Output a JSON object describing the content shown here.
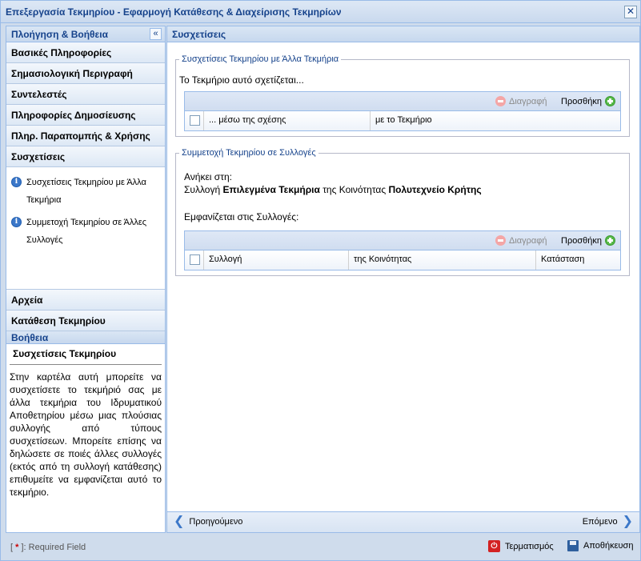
{
  "window": {
    "title": "Επεξεργασία Τεκμηρίου - Εφαρμογή Κατάθεσης & Διαχείρισης Τεκμηρίων",
    "close_glyph": "✕"
  },
  "sidebar": {
    "header": "Πλοήγηση & Βοήθεια",
    "collapse_glyph": "«",
    "items": [
      {
        "label": "Βασικές Πληροφορίες"
      },
      {
        "label": "Σημασιολογική Περιγραφή"
      },
      {
        "label": "Συντελεστές"
      },
      {
        "label": "Πληροφορίες Δημοσίευσης"
      },
      {
        "label": "Πληρ. Παραπομπής & Χρήσης"
      },
      {
        "label": "Συσχετίσεις"
      }
    ],
    "subitems": [
      {
        "label": "Συσχετίσεις Τεκμηρίου με Άλλα Τεκμήρια",
        "icon": "info-icon"
      },
      {
        "label": "Συμμετοχή Τεκμηρίου σε Άλλες Συλλογές",
        "icon": "info-icon"
      }
    ],
    "bottom_items": [
      {
        "label": "Αρχεία"
      },
      {
        "label": "Κατάθεση Τεκμηρίου"
      }
    ]
  },
  "help": {
    "header": "Βοήθεια",
    "title": "Συσχετίσεις Τεκμηρίου",
    "text": "Στην καρτέλα αυτή μπορείτε να συσχετίσετε το τεκμήριό σας με άλλα τεκμήρια του Ιδρυματικού Αποθετηρίου μέσω μιας πλούσιας συλλογής από τύπους συσχετίσεων. Μπορείτε επίσης να δηλώσετε σε ποιές άλλες συλλογές (εκτός από τη συλλογή κατάθεσης) επιθυμείτε να εμφανίζεται αυτό το τεκμήριο."
  },
  "main": {
    "header": "Συσχετίσεις",
    "relations": {
      "legend": "Συσχετίσεις Τεκμηρίου με Άλλα Τεκμήρια",
      "intro": "Το Τεκμήριο αυτό σχετίζεται...",
      "delete_label": "Διαγραφή",
      "add_label": "Προσθήκη",
      "columns": [
        "... μέσω της σχέσης",
        "με το Τεκμήριο"
      ]
    },
    "collections": {
      "legend": "Συμμετοχή Τεκμηρίου σε Συλλογές",
      "belongs_label": "Ανήκει στη:",
      "collection_prefix": "Συλλογή",
      "collection_name": "Επιλεγμένα Τεκμήρια",
      "community_prefix": "της Κοινότητας",
      "community_name": "Πολυτεχνείο Κρήτης",
      "appears_label": "Εμφανίζεται στις Συλλογές:",
      "delete_label": "Διαγραφή",
      "add_label": "Προσθήκη",
      "columns": [
        "Συλλογή",
        "της Κοινότητας",
        "Κατάσταση"
      ]
    },
    "nav": {
      "prev_label": "Προηγούμενο",
      "next_label": "Επόμενο"
    }
  },
  "statusbar": {
    "required_open": "[ ",
    "required_star": "*",
    "required_close": " ]: Required Field",
    "cancel_label": "Τερματισμός",
    "save_label": "Αποθήκευση"
  }
}
